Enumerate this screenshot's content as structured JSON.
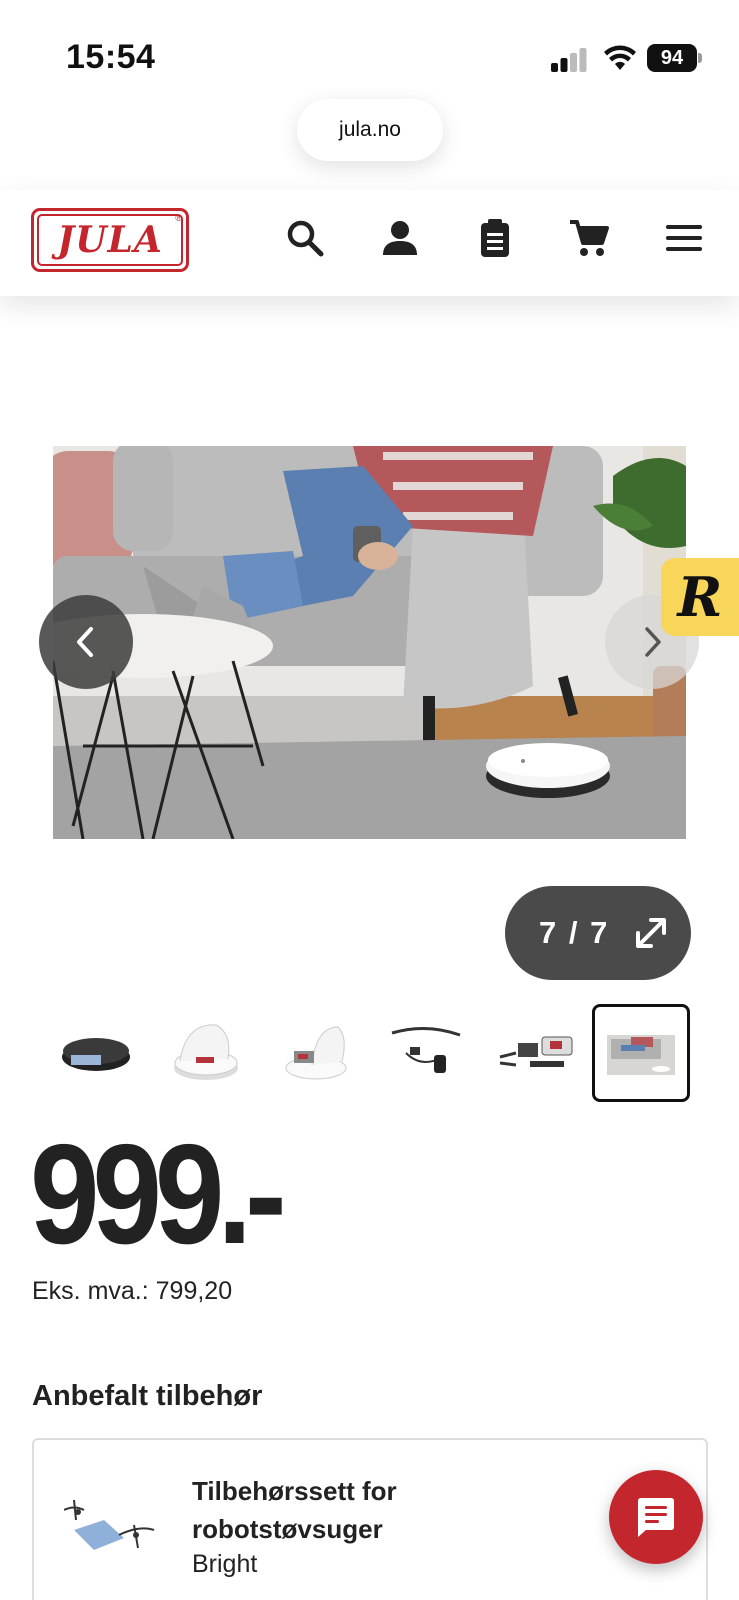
{
  "status_bar": {
    "time": "15:54",
    "battery": "94"
  },
  "browser": {
    "url": "jula.no"
  },
  "header": {
    "logo_text": "JULA",
    "logo_mark": "®",
    "icons": [
      "search-icon",
      "user-icon",
      "clipboard-icon",
      "cart-icon",
      "menu-icon"
    ]
  },
  "gallery": {
    "counter": "7 / 7",
    "current": 7,
    "total": 7,
    "widget_letter": "R"
  },
  "price": {
    "amount": "999.-",
    "ex_vat": "Eks. mva.: 799,20"
  },
  "accessories": {
    "heading": "Anbefalt tilbehør",
    "items": [
      {
        "title": "Tilbehørssett for robotstøvsuger",
        "subtitle": "Bright"
      }
    ]
  },
  "colors": {
    "brand_red": "#c4262e",
    "text": "#222222",
    "widget_yellow": "#f7d65a"
  }
}
